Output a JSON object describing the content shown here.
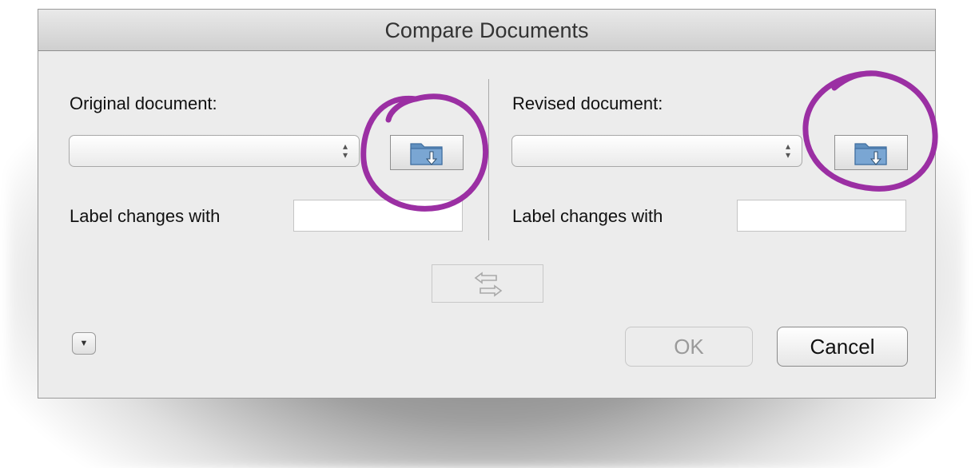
{
  "dialog": {
    "title": "Compare Documents"
  },
  "original": {
    "label": "Original document:",
    "selected_value": "",
    "browse_icon": "folder-browse-icon",
    "label_changes_text": "Label changes with",
    "label_changes_value": ""
  },
  "revised": {
    "label": "Revised document:",
    "selected_value": "",
    "browse_icon": "folder-browse-icon",
    "label_changes_text": "Label changes with",
    "label_changes_value": ""
  },
  "swap_icon": "swap-arrows-icon",
  "disclosure_icon": "triangle-down-icon",
  "buttons": {
    "ok": "OK",
    "cancel": "Cancel"
  },
  "colors": {
    "annotation": "#9b2fa3",
    "folder_blue": "#5f8fbf"
  }
}
